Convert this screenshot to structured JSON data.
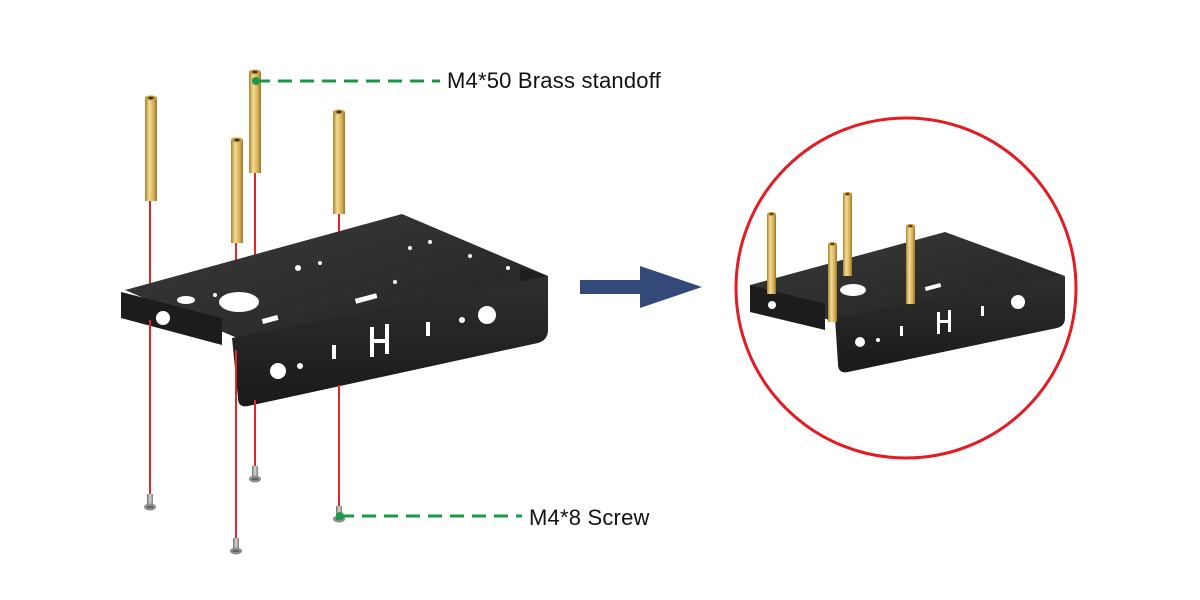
{
  "callouts": {
    "standoff": {
      "label": "M4*50 Brass standoff"
    },
    "screw": {
      "label": "M4*8 Screw"
    }
  },
  "colors": {
    "plate": "#2b2b2b",
    "plate_edge": "#3a3a3a",
    "plate_highlight": "#4a4a4a",
    "brass": "#d9b25a",
    "brass_light": "#f3dc95",
    "brass_dark": "#a9822f",
    "guide_line": "#e0262a",
    "callout_line": "#1b9a45",
    "arrow": "#33497a",
    "zoom_circle": "#e31b23",
    "screw": "#9a9a9a"
  }
}
